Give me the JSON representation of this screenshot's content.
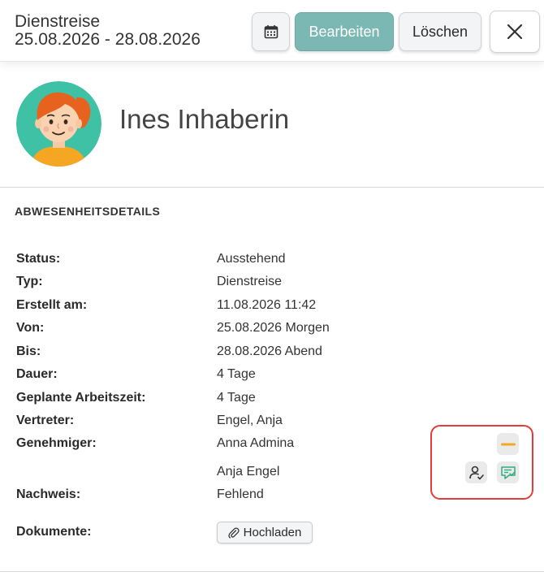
{
  "header": {
    "title": "Dienstreise",
    "date_range": "25.08.2026 - 28.08.2026",
    "calendar_icon": "calendar-icon",
    "edit_label": "Bearbeiten",
    "delete_label": "Löschen",
    "close_icon": "close-icon",
    "accent_color": "#7cb8b3"
  },
  "profile": {
    "name": "Ines Inhaberin",
    "avatar_icon": "avatar-girl-illustration"
  },
  "details": {
    "section_title": "ABWESENHEITSDETAILS",
    "rows": [
      {
        "label": "Status:",
        "value": "Ausstehend"
      },
      {
        "label": "Typ:",
        "value": "Dienstreise"
      },
      {
        "label": "Erstellt am:",
        "value": "11.08.2026 11:42"
      },
      {
        "label": "Von:",
        "value": "25.08.2026 Morgen"
      },
      {
        "label": "Bis:",
        "value": "28.08.2026 Abend"
      },
      {
        "label": "Dauer:",
        "value": "4 Tage"
      },
      {
        "label": "Geplante Arbeitszeit:",
        "value": "4 Tage"
      },
      {
        "label": "Vertreter:",
        "value": "Engel, Anja"
      }
    ],
    "approver_label": "Genehmiger:",
    "approvers": [
      {
        "name": "Anna Admina",
        "status_icon": "pending-dash-icon",
        "status_color": "#f5a623"
      },
      {
        "name": "Anja Engel",
        "icons": [
          "user-check-icon",
          "comment-check-icon"
        ],
        "status_color": "#2fae7e"
      }
    ],
    "proof_label": "Nachweis:",
    "proof_value": "Fehlend",
    "documents_label": "Dokumente:",
    "upload_label": "Hochladen",
    "upload_icon": "paperclip-icon"
  }
}
